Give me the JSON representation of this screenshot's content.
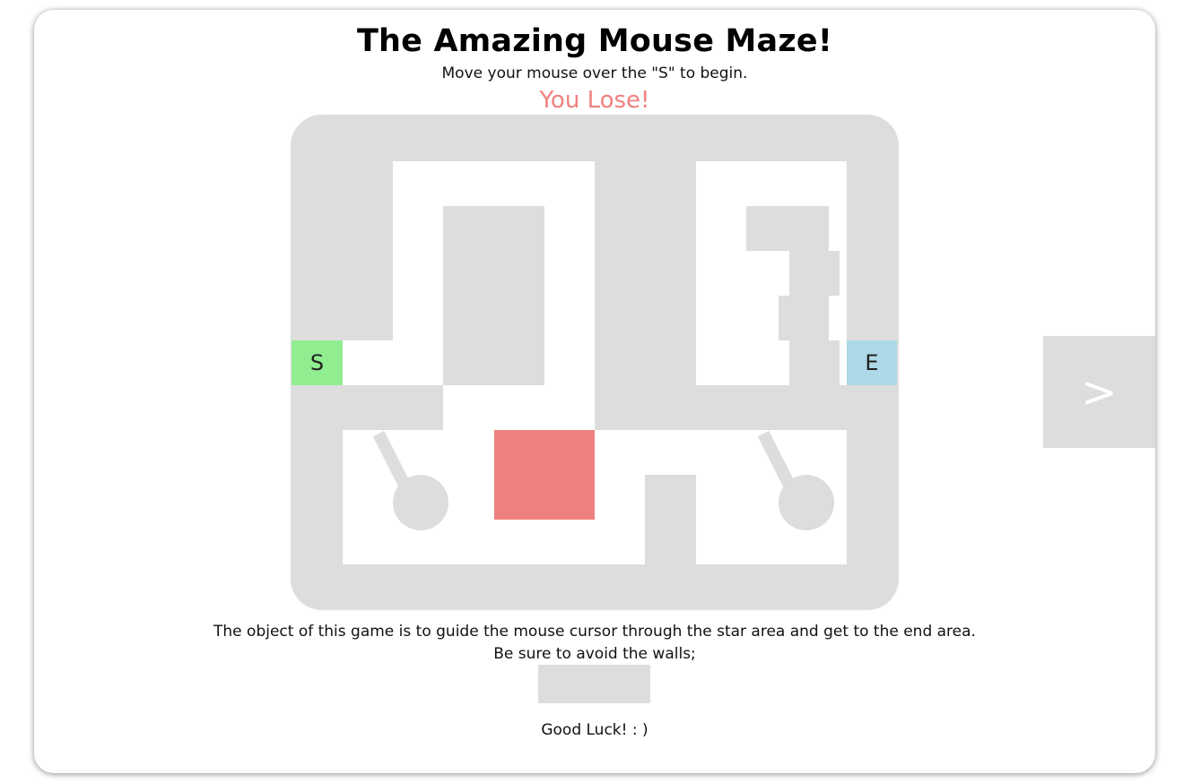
{
  "header": {
    "title": "The Amazing Mouse Maze!",
    "subtitle": "Move your mouse over the \"S\" to begin.",
    "status": "You Lose!"
  },
  "maze": {
    "start_label": "S",
    "end_label": "E",
    "colors": {
      "wall": "#dddddd",
      "path": "#ffffff",
      "start": "#90ee90",
      "end": "#add8e6",
      "hazard": "#f08080",
      "lose_text": "#f08080"
    }
  },
  "navigation": {
    "next_label": ">"
  },
  "instructions": {
    "line1": "The object of this game is to guide the mouse cursor through the star area and get to the end area.",
    "line2": "Be sure to avoid the walls;",
    "closing": "Good Luck! : )"
  }
}
